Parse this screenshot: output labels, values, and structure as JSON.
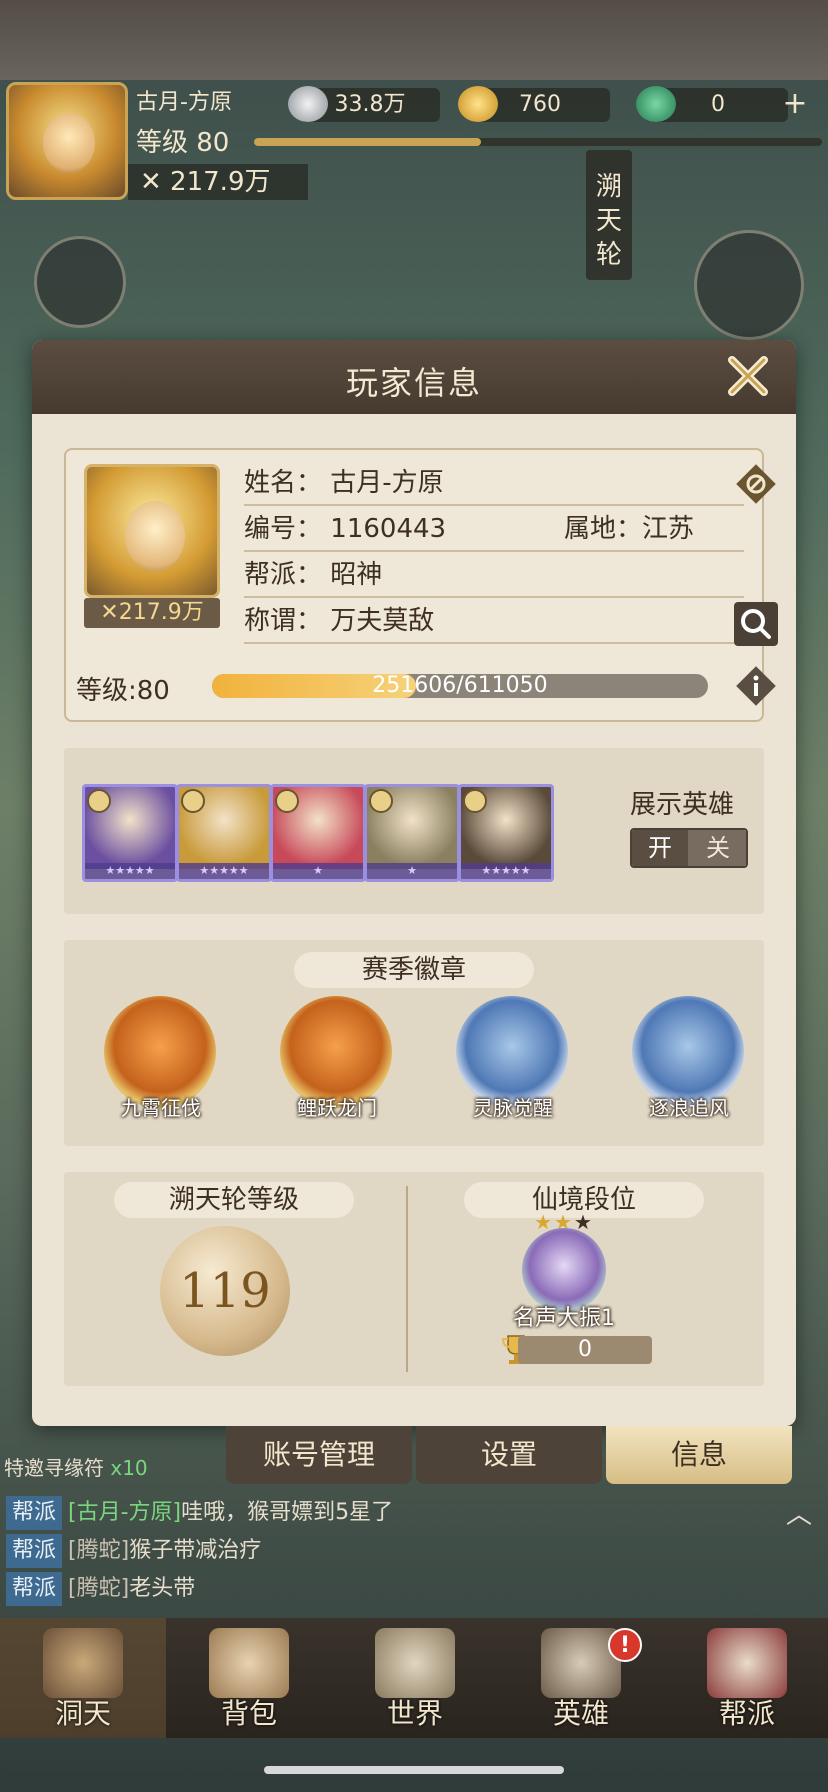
{
  "hud": {
    "player_name": "古月-方原",
    "level_text": "等级 80",
    "power": "✕ 217.9万",
    "silver": "33.8万",
    "gold": "760",
    "jade": "0",
    "plus": "+",
    "side_wheel_label": "溯天轮"
  },
  "modal": {
    "title": "玩家信息",
    "name_key": "姓名：",
    "name_value": "古月-方原",
    "id_key": "编号：",
    "id_value": "1160443",
    "loc_key": "属地：",
    "loc_value": "江苏",
    "guild_key": "帮派：",
    "guild_value": "昭神",
    "title_key": "称谓：",
    "title_value": "万夫莫敌",
    "portrait_power": "✕217.9万",
    "level_label": "等级:80",
    "xp_text": "251606/611050",
    "xp_fraction": 0.412
  },
  "heroes": {
    "show_label": "展示英雄",
    "toggle_on": "开",
    "toggle_off": "关",
    "slots": [
      {
        "stars": "★★★★★",
        "color": "#6b4fa0"
      },
      {
        "stars": "★★★★★",
        "color": "#c89a3a"
      },
      {
        "stars": "★",
        "color": "#c84a5a"
      },
      {
        "stars": "★",
        "color": "#8a8060"
      },
      {
        "stars": "★★★★★",
        "color": "#5a4a3a"
      }
    ]
  },
  "season_badges": {
    "title": "赛季徽章",
    "items": [
      {
        "name": "九霄征伐",
        "style": "gold"
      },
      {
        "name": "鲤跃龙门",
        "style": "gold"
      },
      {
        "name": "灵脉觉醒",
        "style": "blue"
      },
      {
        "name": "逐浪追风",
        "style": "blue"
      }
    ]
  },
  "rank": {
    "wheel_title": "溯天轮等级",
    "wheel_level": "119",
    "realm_title": "仙境段位",
    "realm_name": "名声大振1",
    "realm_score": "0"
  },
  "tabs": {
    "account": "账号管理",
    "settings": "设置",
    "info": "信息"
  },
  "chat": {
    "invite_text": "特邀寻缘符",
    "invite_mult": "x10",
    "rows": [
      {
        "tag": "帮派",
        "who": "[古月-方原]",
        "msg": "哇哦，猴哥嫖到5星了"
      },
      {
        "tag": "帮派",
        "who": "[腾蛇]",
        "msg": "猴子带减治疗"
      },
      {
        "tag": "帮派",
        "who": "[腾蛇]",
        "msg": "老头带"
      }
    ]
  },
  "nav": {
    "items": [
      "洞天",
      "背包",
      "世界",
      "英雄",
      "帮派"
    ],
    "alert": "!"
  }
}
